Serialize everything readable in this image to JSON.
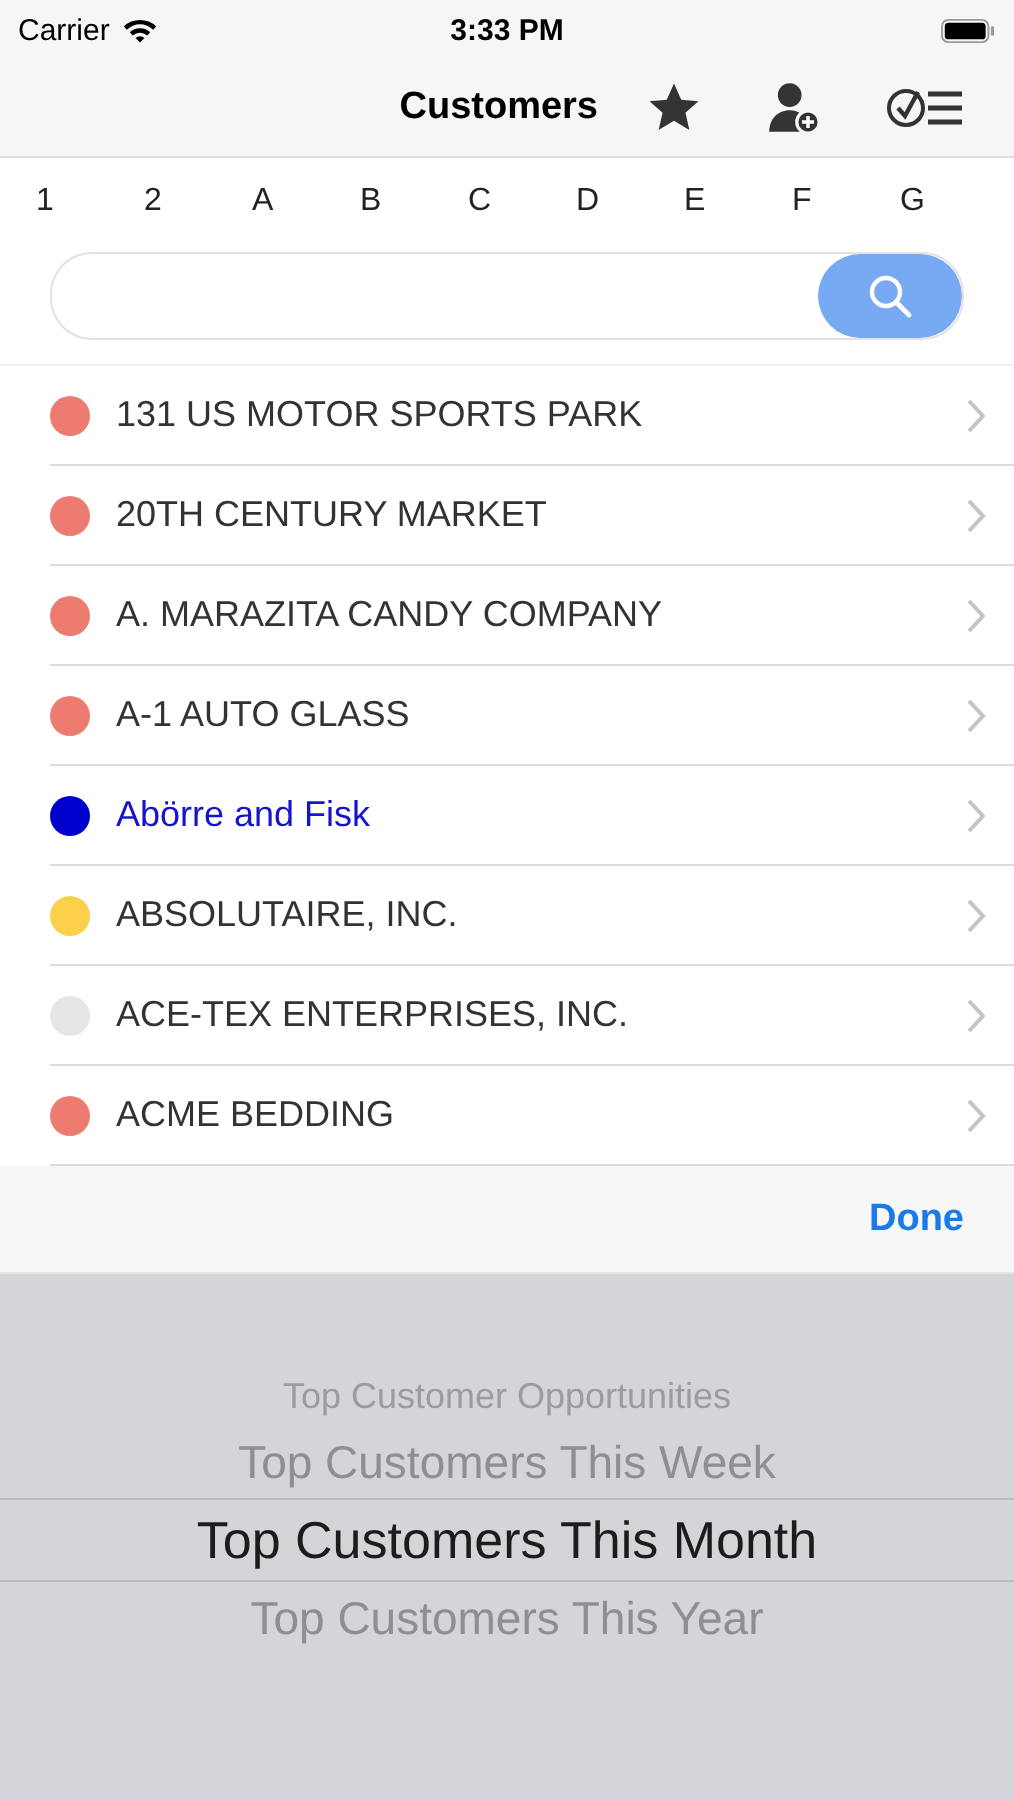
{
  "status_bar": {
    "carrier": "Carrier",
    "time": "3:33 PM"
  },
  "nav": {
    "title": "Customers"
  },
  "index": [
    "1",
    "2",
    "A",
    "B",
    "C",
    "D",
    "E",
    "F",
    "G"
  ],
  "customers": [
    {
      "name": "131 US MOTOR SPORTS PARK",
      "color": "#ee7b70",
      "highlighted": false
    },
    {
      "name": "20TH CENTURY MARKET",
      "color": "#ee7b70",
      "highlighted": false
    },
    {
      "name": "A. MARAZITA CANDY COMPANY",
      "color": "#ee7b70",
      "highlighted": false
    },
    {
      "name": "A-1 AUTO GLASS",
      "color": "#ee7b70",
      "highlighted": false
    },
    {
      "name": "Abörre and Fisk",
      "color": "#0000cc",
      "highlighted": true
    },
    {
      "name": "ABSOLUTAIRE, INC.",
      "color": "#fbd14b",
      "highlighted": false
    },
    {
      "name": "ACE-TEX ENTERPRISES, INC.",
      "color": "#e6e6e6",
      "highlighted": false
    },
    {
      "name": "ACME BEDDING",
      "color": "#ee7b70",
      "highlighted": false
    }
  ],
  "toolbar": {
    "done": "Done"
  },
  "picker": [
    {
      "label": "Top Customer Opportunities",
      "selected": false
    },
    {
      "label": "Top Customers This Week",
      "selected": false
    },
    {
      "label": "Top Customers This Month",
      "selected": true
    },
    {
      "label": "Top Customers This Year",
      "selected": false
    }
  ]
}
